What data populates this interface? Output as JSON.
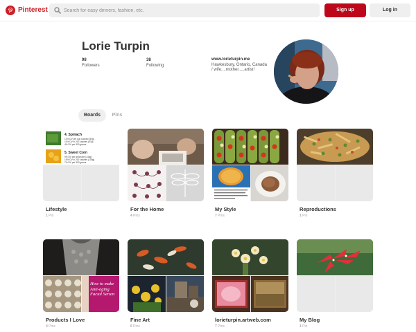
{
  "header": {
    "brand": "Pinterest",
    "search_placeholder": "Search for easy dinners, fashion, etc.",
    "signup_label": "Sign up",
    "login_label": "Log in"
  },
  "profile": {
    "name": "Lorie Turpin",
    "followers_count": "98",
    "followers_label": "Followers",
    "following_count": "38",
    "following_label": "Following",
    "website": "www.lorieturpin.me",
    "bio": "Hawkesbury, Ontario, Canada / wife....mother.....artist!"
  },
  "tabs": {
    "boards": "Boards",
    "pins": "Pins"
  },
  "board_covers": {
    "lifestyle": [
      {
        "title": "4. Spinach",
        "lines": [
          "12% DV per cup cooked (50g)",
          "10% DV in 200 calories (97g)",
          "4% DV per 300 grams"
        ]
      },
      {
        "title": "5. Sweet Corn",
        "lines": [
          "9% DV per artichoke (145g)",
          "15% DV in 200 calories (100g)",
          "7% DV per 300 grams"
        ]
      }
    ],
    "products_overlay": "How to make Anti-aging Facial Serum"
  },
  "boards": [
    {
      "title": "Lifestyle",
      "count": "1",
      "unit": "Pin"
    },
    {
      "title": "For the Home",
      "count": "4",
      "unit": "Pins"
    },
    {
      "title": "My Style",
      "count": "7",
      "unit": "Pins"
    },
    {
      "title": "Reproductions",
      "count": "1",
      "unit": "Pin"
    },
    {
      "title": "Products I Love",
      "count": "4",
      "unit": "Pins"
    },
    {
      "title": "Fine Art",
      "count": "6",
      "unit": "Pins"
    },
    {
      "title": "lorieturpin.artweb.com",
      "count": "7",
      "unit": "Pins"
    },
    {
      "title": "My Blog",
      "count": "1",
      "unit": "Pin"
    }
  ]
}
